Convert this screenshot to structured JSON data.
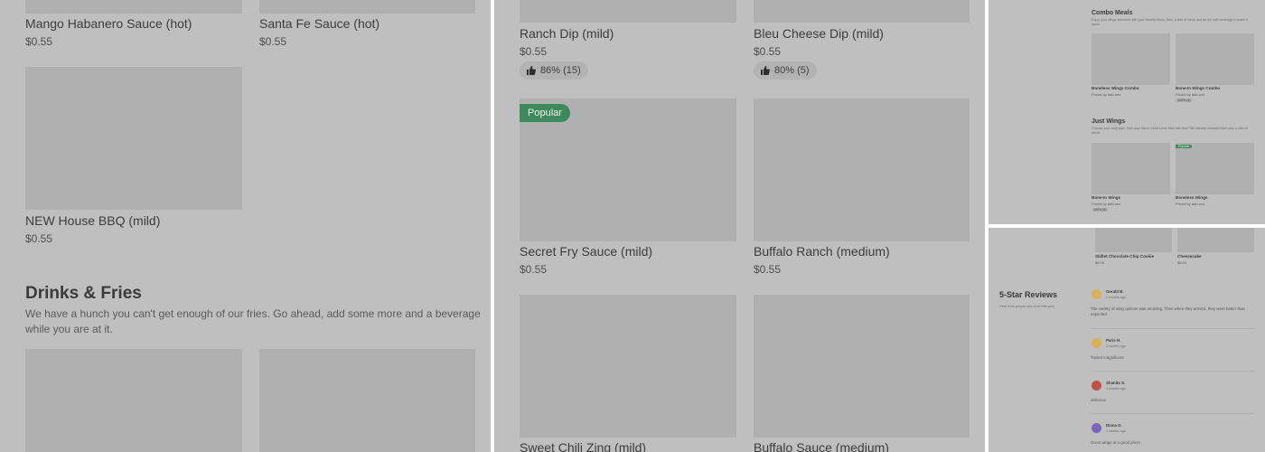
{
  "left_panel": {
    "items_top": [
      {
        "title": "Mango Habanero Sauce (hot)",
        "price": "$0.55"
      },
      {
        "title": "Santa Fe Sauce (hot)",
        "price": "$0.55"
      }
    ],
    "item_mid": {
      "title": "NEW House BBQ (mild)",
      "price": "$0.55"
    },
    "section": {
      "heading": "Drinks & Fries",
      "description": "We have a hunch you can't get enough of our fries. Go ahead, add some more and a beverage while you are at it."
    }
  },
  "mid_panel": {
    "row1": [
      {
        "title": "Ranch Dip (mild)",
        "price": "$0.55",
        "rating": "86% (15)"
      },
      {
        "title": "Bleu Cheese Dip (mild)",
        "price": "$0.55",
        "rating": "80% (5)"
      }
    ],
    "row2": [
      {
        "title": "Secret Fry Sauce (mild)",
        "price": "$0.55",
        "badge": "Popular"
      },
      {
        "title": "Buffalo Ranch (medium)",
        "price": "$0.55"
      }
    ],
    "row3": [
      {
        "title": "Sweet Chili Zing (mild)"
      },
      {
        "title": "Buffalo Sauce (medium)"
      }
    ]
  },
  "top_right_panel": {
    "combo": {
      "heading": "Combo Meals",
      "description": "Enjoy your wings drenched with your favorite flavor, fries, a side of ranch and an ice cold beverage to wash it down.",
      "items": [
        {
          "title": "Boneless Wings Combo",
          "price": "Priced by add-ons"
        },
        {
          "title": "Bone-In Wings Combo",
          "price": "Priced by add-ons",
          "rating": "100% (3)"
        }
      ]
    },
    "just_wings": {
      "heading": "Just Wings",
      "description": "Choose your wing style, then your flavor; short some fries with that? We already included them plus a side of ranch.",
      "items": [
        {
          "title": "Bone-In Wings",
          "price": "Priced by add-ons",
          "rating": "100% (6)"
        },
        {
          "title": "Boneless Wings",
          "price": "Priced by add-ons",
          "badge": "Popular"
        }
      ]
    }
  },
  "bottom_right_panel": {
    "desserts": [
      {
        "title": "Skillet Chocolate Chip Cookie",
        "price": "$4.00"
      },
      {
        "title": "Cheesecake",
        "price": "$5.00"
      }
    ],
    "reviews": {
      "heading": "5-Star Reviews",
      "subheading": "Hear from people who love this spot",
      "items": [
        {
          "name": "Gerald B.",
          "time": "2 months ago",
          "text": "The variety of wing options was amazing. Then when they arrived, they were better than expected.",
          "avatar_color": "#d8b25a"
        },
        {
          "name": "Paris H.",
          "time": "2 months ago",
          "text": "Tasted magnificent",
          "avatar_color": "#d8b25a"
        },
        {
          "name": "Shanita S.",
          "time": "4 months ago",
          "text": "delicious",
          "avatar_color": "#c0504a"
        },
        {
          "name": "Diana G.",
          "time": "4 months ago",
          "text": "Great wings at a good price!",
          "avatar_color": "#7a66b8"
        }
      ]
    }
  }
}
